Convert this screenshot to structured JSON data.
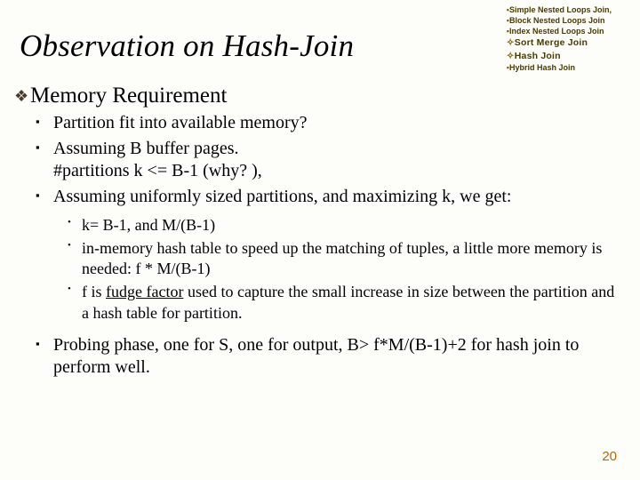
{
  "title": "Observation on Hash-Join",
  "toc": {
    "items": [
      "Simple Nested Loops Join,",
      "Block Nested Loops Join",
      "Index Nested Loops Join",
      "Sort Merge Join",
      "Hash Join",
      "Hybrid Hash Join"
    ]
  },
  "heading": "Memory Requirement",
  "bullets": {
    "b1": "Partition fit into available memory?",
    "b2": "Assuming B buffer pages.\n#partitions k <= B-1 (why? ),",
    "b3": "Assuming uniformly sized partitions, and maximizing k, we get:",
    "sub": {
      "s1": "k= B-1,  and M/(B-1)",
      "s2": "in-memory hash table to speed up the matching of tuples, a little more memory is needed:   f * M/(B-1)",
      "s3a": "f is ",
      "s3u": "fudge factor",
      "s3b": " used to capture the small increase in size between the partition and a hash table for partition."
    },
    "b4": "Probing phase, one for S, one for output, B> f*M/(B-1)+2 for hash join to perform well."
  },
  "page_number": "20"
}
